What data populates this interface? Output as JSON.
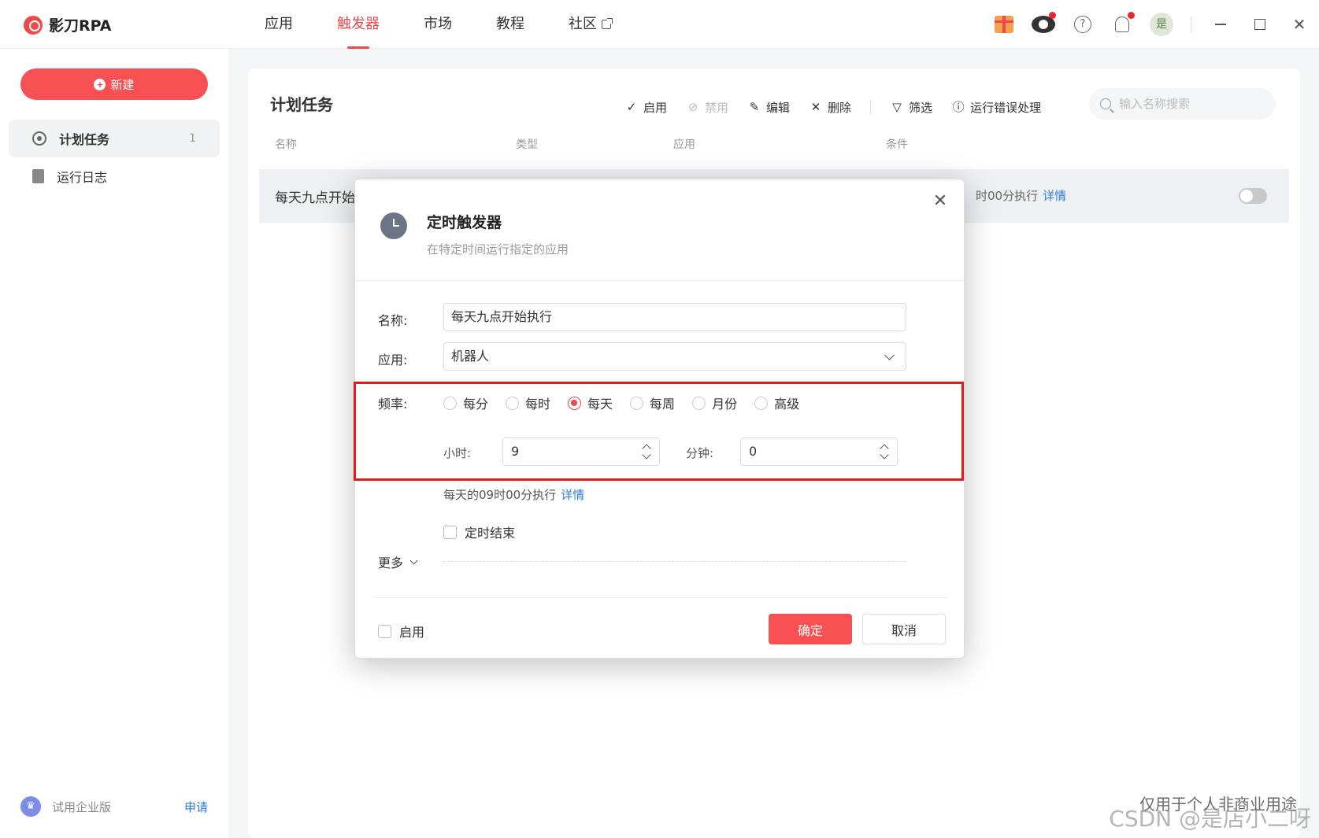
{
  "app": {
    "name": "影刀RPA"
  },
  "nav": {
    "items": [
      {
        "label": "应用"
      },
      {
        "label": "触发器"
      },
      {
        "label": "市场"
      },
      {
        "label": "教程"
      },
      {
        "label": "社区"
      }
    ],
    "active_index": 1
  },
  "topbar": {
    "avatar_text": "是"
  },
  "sidebar": {
    "new_label": "新建",
    "items": [
      {
        "label": "计划任务",
        "count": "1"
      },
      {
        "label": "运行日志"
      }
    ],
    "trial_label": "试用企业版",
    "trial_link": "申请"
  },
  "main": {
    "title": "计划任务",
    "toolbar": {
      "enable": "启用",
      "disable": "禁用",
      "edit": "编辑",
      "delete": "删除",
      "filter": "筛选",
      "error_handling": "运行错误处理"
    },
    "search_placeholder": "输入名称搜索",
    "columns": [
      "名称",
      "类型",
      "应用",
      "条件"
    ],
    "row": {
      "name": "每天九点开始",
      "condition": "时00分执行",
      "detail": "详情"
    }
  },
  "modal": {
    "title": "定时触发器",
    "subtitle": "在特定时间运行指定的应用",
    "name_label": "名称:",
    "name_value": "每天九点开始执行",
    "app_label": "应用:",
    "app_value": "机器人",
    "freq_label": "频率:",
    "freq_options": [
      "每分",
      "每时",
      "每天",
      "每周",
      "月份",
      "高级"
    ],
    "freq_selected": "每天",
    "hour_label": "小时:",
    "hour_value": "9",
    "minute_label": "分钟:",
    "minute_value": "0",
    "summary": "每天的09时00分执行",
    "summary_link": "详情",
    "end_label": "定时结束",
    "more_label": "更多",
    "enable_label": "启用",
    "ok": "确定",
    "cancel": "取消"
  },
  "watermark": {
    "line1": "仅用于个人非商业用途",
    "line2": "CSDN @是店小二呀"
  },
  "colors": {
    "accent": "#f65052",
    "link": "#2f7cd8",
    "highlight": "#e51a1a"
  }
}
